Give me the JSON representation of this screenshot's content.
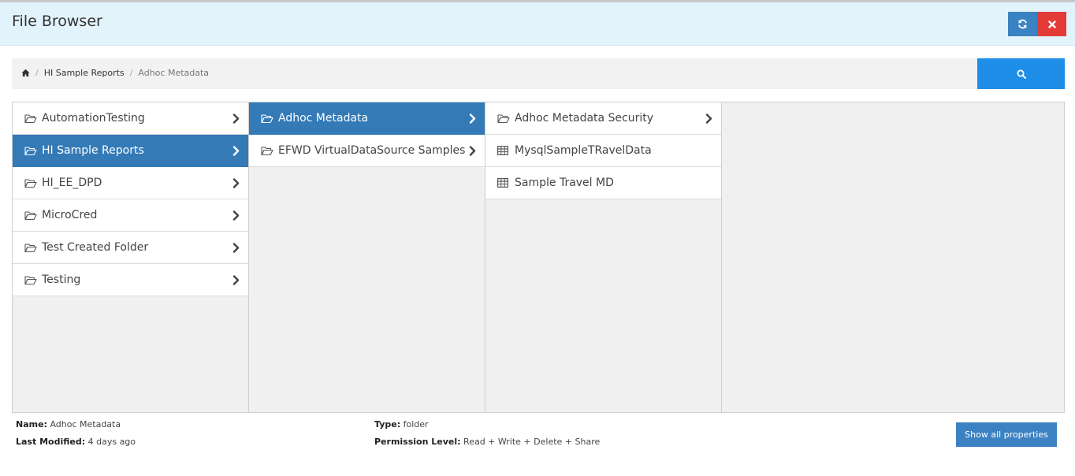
{
  "header": {
    "title": "File Browser",
    "refresh_icon": "refresh-icon",
    "close_icon": "close-icon"
  },
  "breadcrumb": {
    "home_icon": "home-icon",
    "items": [
      "HI Sample Reports",
      "Adhoc Metadata"
    ]
  },
  "search": {
    "icon": "search-icon"
  },
  "columns": [
    {
      "items": [
        {
          "label": "AutomationTesting",
          "type": "folder"
        },
        {
          "label": "HI Sample Reports",
          "type": "folder",
          "selected": true
        },
        {
          "label": "HI_EE_DPD",
          "type": "folder"
        },
        {
          "label": "MicroCred",
          "type": "folder"
        },
        {
          "label": "Test Created Folder",
          "type": "folder"
        },
        {
          "label": "Testing",
          "type": "folder"
        }
      ]
    },
    {
      "items": [
        {
          "label": "Adhoc Metadata",
          "type": "folder",
          "selected": true
        },
        {
          "label": "EFWD VirtualDataSource Samples",
          "type": "folder"
        }
      ]
    },
    {
      "items": [
        {
          "label": "Adhoc Metadata Security",
          "type": "folder"
        },
        {
          "label": "MysqlSampleTRavelData",
          "type": "metadata"
        },
        {
          "label": "Sample Travel MD",
          "type": "metadata"
        }
      ]
    }
  ],
  "properties": {
    "name_label": "Name:",
    "name_value": "Adhoc Metadata",
    "modified_label": "Last Modified:",
    "modified_value": "4 days ago",
    "type_label": "Type:",
    "type_value": "folder",
    "permission_label": "Permission Level:",
    "permission_value": "Read + Write + Delete + Share",
    "show_all_label": "Show all properties"
  },
  "colors": {
    "selected": "#337ab7",
    "search": "#1e8ee8",
    "close": "#e33b36",
    "header_bg": "#e3f3fb"
  }
}
